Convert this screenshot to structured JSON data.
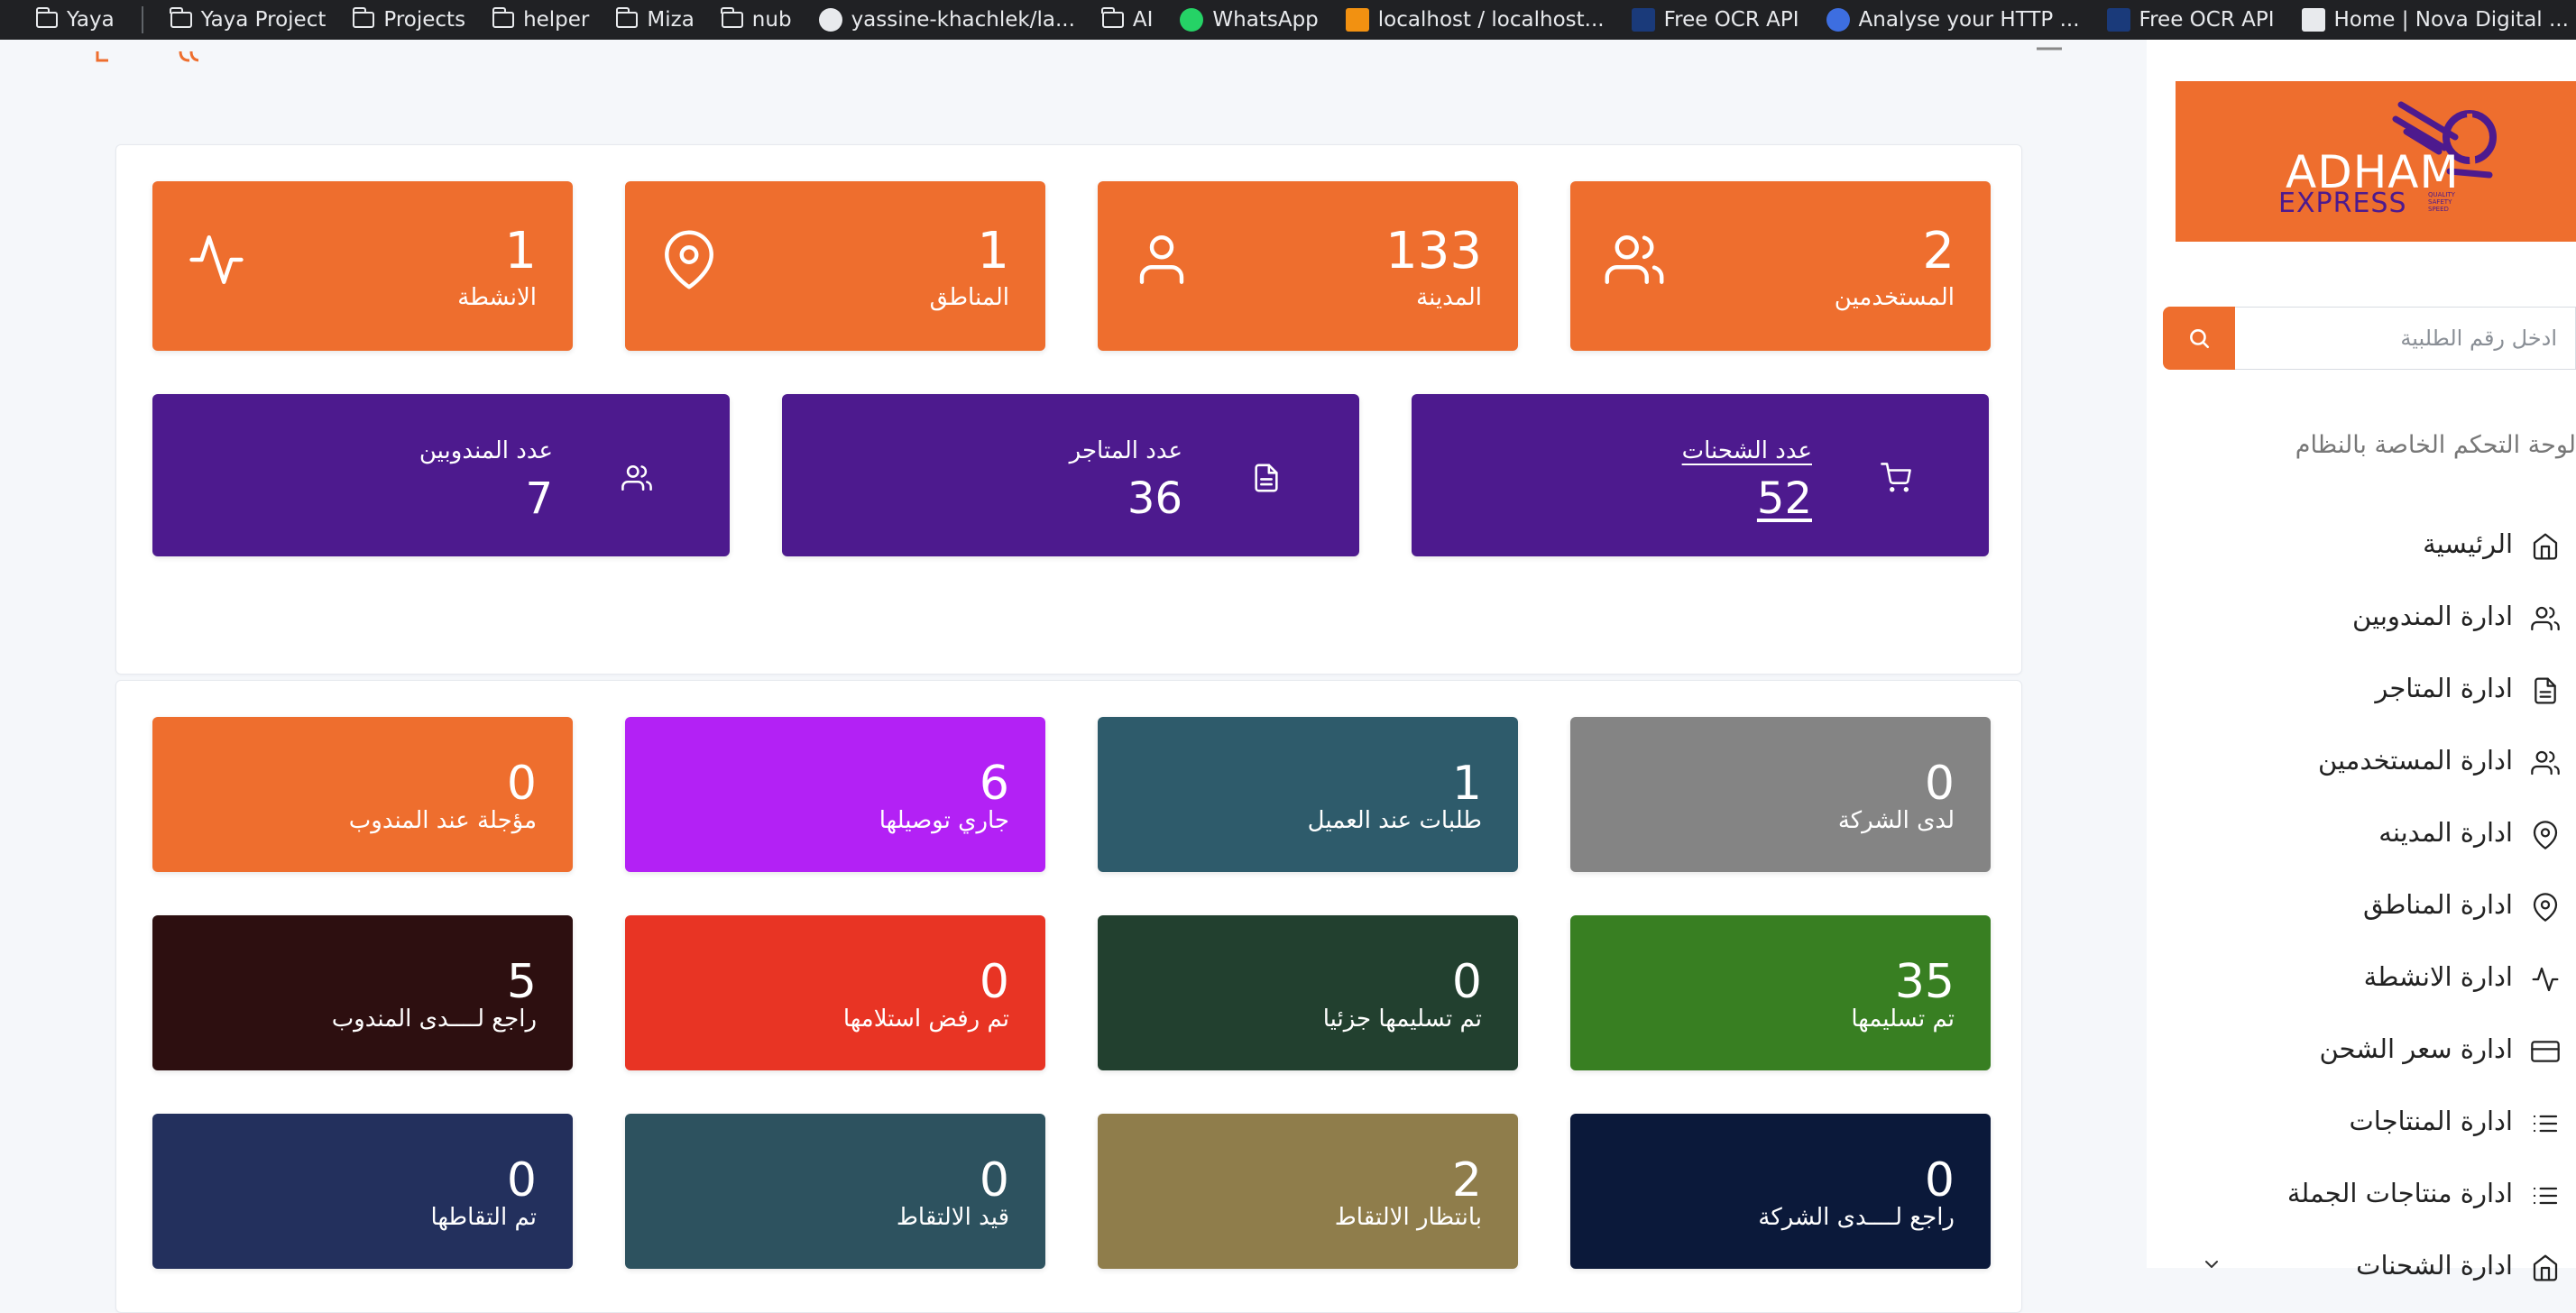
{
  "bookmarks": [
    {
      "label": "Yaya",
      "icon": "folder-icon"
    },
    {
      "label": "Yaya Project",
      "icon": "folder-icon"
    },
    {
      "label": "Projects",
      "icon": "folder-icon"
    },
    {
      "label": "helper",
      "icon": "folder-icon"
    },
    {
      "label": "Miza",
      "icon": "folder-icon"
    },
    {
      "label": "nub",
      "icon": "folder-icon"
    },
    {
      "label": "yassine-khachlek/la...",
      "icon": "github-icon"
    },
    {
      "label": "AI",
      "icon": "folder-icon"
    },
    {
      "label": "WhatsApp",
      "icon": "whatsapp-icon"
    },
    {
      "label": "localhost / localhost...",
      "icon": "phpmyadmin-icon"
    },
    {
      "label": "Free OCR API",
      "icon": "ocr-icon"
    },
    {
      "label": "Analyse your HTTP ...",
      "icon": "star-icon"
    },
    {
      "label": "Free OCR API",
      "icon": "ocr-icon"
    },
    {
      "label": "Home | Nova Digital ...",
      "icon": "nova-icon"
    }
  ],
  "stats_top": [
    {
      "value": "2",
      "label": "المستخدمين",
      "icon": "users-icon"
    },
    {
      "value": "133",
      "label": "المدينة",
      "icon": "user-icon"
    },
    {
      "value": "1",
      "label": "المناطق",
      "icon": "map-pin-icon"
    },
    {
      "value": "1",
      "label": "الانشطة",
      "icon": "activity-icon"
    }
  ],
  "stats_purple": [
    {
      "value": "52",
      "label": "عدد الشحنات",
      "icon": "cart-icon"
    },
    {
      "value": "36",
      "label": "عدد المتاجر",
      "icon": "file-icon"
    },
    {
      "value": "7",
      "label": "عدد المندوبين",
      "icon": "users-icon"
    }
  ],
  "status_boxes": [
    {
      "value": "0",
      "label": "لدى الشركة",
      "color": "#848484"
    },
    {
      "value": "1",
      "label": "طلبات عند العميل",
      "color": "#2e5b6b"
    },
    {
      "value": "6",
      "label": "جاري توصيلها",
      "color": "#b321f5"
    },
    {
      "value": "0",
      "label": "مؤجلة عند المندوب",
      "color": "#ee6e2e"
    },
    {
      "value": "35",
      "label": "تم تسليمها",
      "color": "#387f22"
    },
    {
      "value": "0",
      "label": "تم تسليمها جزئيا",
      "color": "#22402f"
    },
    {
      "value": "0",
      "label": "تم رفض استلامها",
      "color": "#e83424"
    },
    {
      "value": "5",
      "label": "راجع لــــدى المندوب",
      "color": "#2d0f10"
    },
    {
      "value": "0",
      "label": "راجع لــــدى الشركة",
      "color": "#0b193a"
    },
    {
      "value": "2",
      "label": "بانتظار الالتقاط",
      "color": "#8f7d4b"
    },
    {
      "value": "0",
      "label": "قيد الالتقاط",
      "color": "#2d525f"
    },
    {
      "value": "0",
      "label": "تم التقاطها",
      "color": "#23305d"
    }
  ],
  "sidebar": {
    "logo_main": "ADHAM",
    "logo_sub": "EXPRESS",
    "logo_tag": "QUALITY SAFETY SPEED",
    "search_placeholder": "ادخل رقم الطلبية",
    "panel_title": "لوحة التحكم الخاصة بالنظام",
    "items": [
      {
        "label": "الرئيسية",
        "icon": "home-icon"
      },
      {
        "label": "ادارة المندوبين",
        "icon": "users-icon"
      },
      {
        "label": "ادارة المتاجر",
        "icon": "file-icon"
      },
      {
        "label": "ادارة المستخدمين",
        "icon": "users-icon"
      },
      {
        "label": "ادارة المدينه",
        "icon": "map-pin-icon"
      },
      {
        "label": "ادارة المناطق",
        "icon": "map-pin-icon"
      },
      {
        "label": "ادارة الانشطة",
        "icon": "activity-icon"
      },
      {
        "label": "ادارة سعر الشحن",
        "icon": "credit-card-icon"
      },
      {
        "label": "ادارة المنتاجات",
        "icon": "list-icon"
      },
      {
        "label": "ادارة منتاجات الجملة",
        "icon": "list-icon"
      },
      {
        "label": "ادارة الشحنات",
        "icon": "home-icon"
      }
    ]
  },
  "colors": {
    "accent": "#ee6e2e",
    "purple": "#4d1a8e"
  }
}
